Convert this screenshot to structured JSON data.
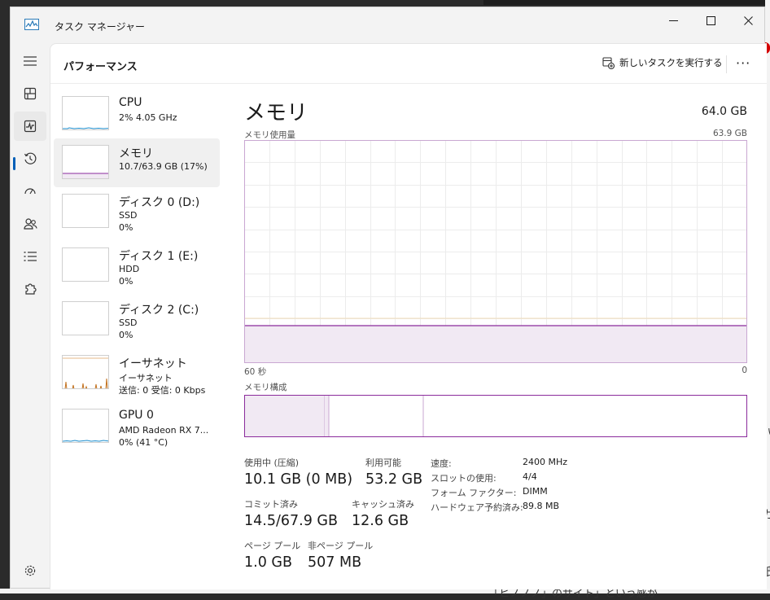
{
  "window": {
    "title": "タスク マネージャー"
  },
  "header": {
    "page_title": "パフォーマンス",
    "run_task_label": "新しいタスクを実行する",
    "more": "···"
  },
  "devices": [
    {
      "name": "CPU",
      "line2": "2%  4.05 GHz",
      "line3": ""
    },
    {
      "name": "メモリ",
      "line2": "10.7/63.9 GB (17%)",
      "line3": ""
    },
    {
      "name": "ディスク 0 (D:)",
      "line2": "SSD",
      "line3": "0%"
    },
    {
      "name": "ディスク 1 (E:)",
      "line2": "HDD",
      "line3": "0%"
    },
    {
      "name": "ディスク 2 (C:)",
      "line2": "SSD",
      "line3": "0%"
    },
    {
      "name": "イーサネット",
      "line2": "イーサネット",
      "line3": "送信: 0 受信: 0 Kbps"
    },
    {
      "name": "GPU 0",
      "line2": "AMD Radeon RX 7...",
      "line3": "0% (41 °C)"
    }
  ],
  "selected_device": "メモリ",
  "memory": {
    "title": "メモリ",
    "total": "64.0 GB",
    "usage_label": "メモリ使用量",
    "usage_max": "63.9 GB",
    "usage_fraction": 0.17,
    "axis_left": "60 秒",
    "axis_right": "0",
    "composition_label": "メモリ構成",
    "stats": {
      "in_use_label": "使用中 (圧縮)",
      "in_use_value": "10.1 GB (0 MB)",
      "available_label": "利用可能",
      "available_value": "53.2 GB",
      "committed_label": "コミット済み",
      "committed_value": "14.5/67.9 GB",
      "cached_label": "キャッシュ済み",
      "cached_value": "12.6 GB",
      "paged_label": "ページ プール",
      "paged_value": "1.0 GB",
      "nonpaged_label": "非ページ プール",
      "nonpaged_value": "507 MB"
    },
    "specs": {
      "speed_label": "速度:",
      "speed_value": "2400 MHz",
      "slots_label": "スロットの使用:",
      "slots_value": "4/4",
      "form_label": "フォーム ファクター:",
      "form_value": "DIMM",
      "reserved_label": "ハードウェア予約済み:",
      "reserved_value": "89.8 MB"
    }
  },
  "background": {
    "bottom_text": "「ヒノノノ」のサイト」という感が"
  },
  "colors": {
    "memory_accent": "#8b2b9c",
    "memory_fill": "#f1e9f3",
    "cpu_accent": "#1a8ccd",
    "ethernet_accent": "#c2711e",
    "active_indicator": "#005fb8"
  }
}
